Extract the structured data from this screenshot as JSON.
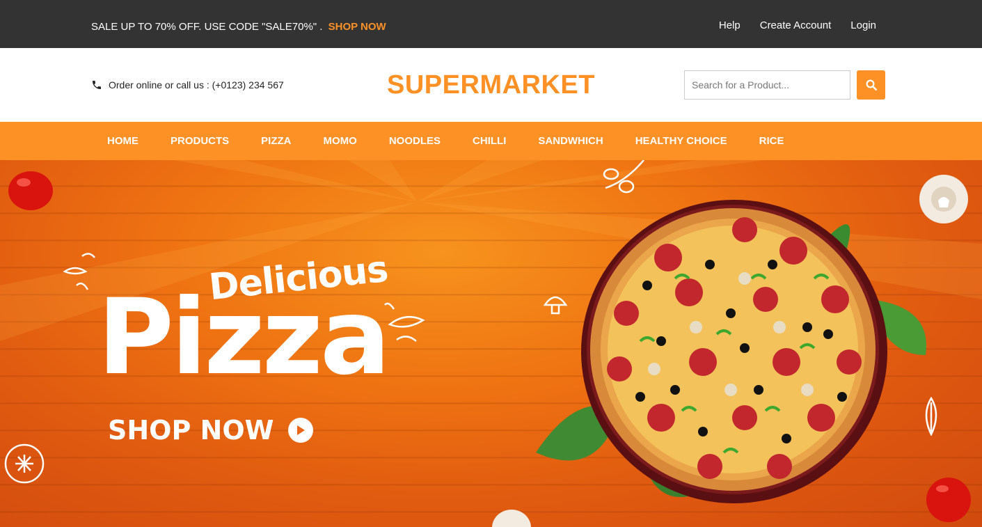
{
  "topbar": {
    "promo_text": "SALE UP TO 70% OFF. USE CODE \"SALE70%\" .",
    "promo_link": "SHOP NOW",
    "links": [
      "Help",
      "Create Account",
      "Login"
    ]
  },
  "header": {
    "phone_text": "Order online or call us : (+0123) 234 567",
    "logo": "SUPERMARKET",
    "search_placeholder": "Search for a Product..."
  },
  "nav": {
    "items": [
      "HOME",
      "PRODUCTS",
      "PIZZA",
      "MOMO",
      "NOODLES",
      "CHILLI",
      "SANDWHICH",
      "HEALTHY CHOICE",
      "RICE"
    ]
  },
  "hero": {
    "tagline": "Delicious",
    "headline": "Pizza",
    "cta": "SHOP NOW"
  },
  "colors": {
    "accent": "#fe9126",
    "topbar_bg": "#333333",
    "hero_bg": "#e8651a"
  },
  "icons": [
    "phone-icon",
    "search-icon",
    "play-icon"
  ]
}
